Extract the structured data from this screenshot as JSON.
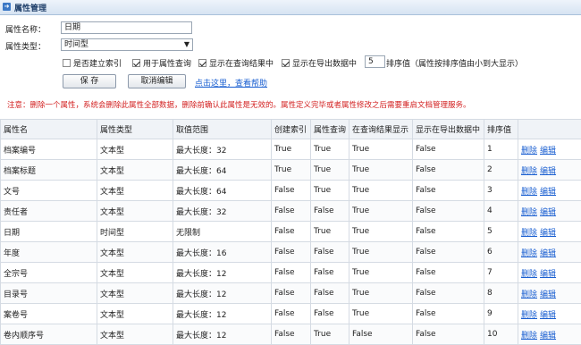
{
  "header": {
    "title": "属性管理",
    "icon": "arrow-icon"
  },
  "form": {
    "name_label": "属性名称：",
    "name_value": "日期",
    "type_label": "属性类型：",
    "type_value": "时间型",
    "cb_index": {
      "label": "是否建立索引",
      "checked": false
    },
    "cb_query": {
      "label": "用于属性查询",
      "checked": true
    },
    "cb_show_result": {
      "label": "显示在查询结果中",
      "checked": true
    },
    "cb_show_export": {
      "label": "显示在导出数据中",
      "checked": true
    },
    "order_value": "5",
    "order_label": "排序值（属性按排序值由小到大显示）",
    "save_label": "保 存",
    "cancel_label": "取消编辑",
    "help_link": "点击这里，查看帮助"
  },
  "notice": "注意：删除一个属性，系统会删除此属性全部数据，删除前确认此属性是无效的。属性定义完毕或者属性修改之后需要重启文档管理服务。",
  "table": {
    "headers": [
      "属性名",
      "属性类型",
      "取值范围",
      "创建索引",
      "属性查询",
      "在查询结果显示",
      "显示在导出数据中",
      "排序值",
      ""
    ],
    "rows": [
      [
        "档案编号",
        "文本型",
        "最大长度：32",
        "True",
        "True",
        "True",
        "False",
        "1"
      ],
      [
        "档案标题",
        "文本型",
        "最大长度：64",
        "True",
        "True",
        "True",
        "False",
        "2"
      ],
      [
        "文号",
        "文本型",
        "最大长度：64",
        "False",
        "True",
        "True",
        "False",
        "3"
      ],
      [
        "责任者",
        "文本型",
        "最大长度：32",
        "False",
        "False",
        "True",
        "False",
        "4"
      ],
      [
        "日期",
        "时间型",
        "无限制",
        "False",
        "True",
        "True",
        "False",
        "5"
      ],
      [
        "年度",
        "文本型",
        "最大长度：16",
        "False",
        "False",
        "True",
        "False",
        "6"
      ],
      [
        "全宗号",
        "文本型",
        "最大长度：12",
        "False",
        "False",
        "True",
        "False",
        "7"
      ],
      [
        "目录号",
        "文本型",
        "最大长度：12",
        "False",
        "False",
        "True",
        "False",
        "8"
      ],
      [
        "案卷号",
        "文本型",
        "最大长度：12",
        "False",
        "False",
        "True",
        "False",
        "9"
      ],
      [
        "卷内顺序号",
        "文本型",
        "最大长度：12",
        "False",
        "True",
        "False",
        "False",
        "10"
      ]
    ],
    "action_delete": "删除",
    "action_edit": "编辑"
  },
  "colors": {
    "link": "#1a5fd1",
    "notice": "#d32222",
    "header_bg": "#f0f3f7"
  }
}
